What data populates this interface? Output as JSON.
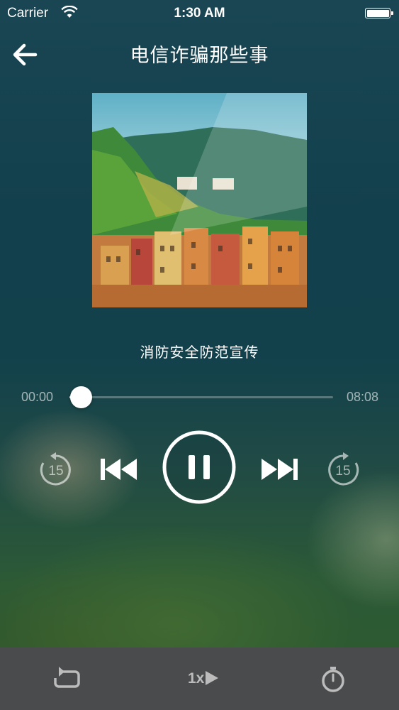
{
  "status_bar": {
    "carrier": "Carrier",
    "time": "1:30 AM"
  },
  "header": {
    "title": "电信诈骗那些事",
    "back_icon": "arrow-left-icon"
  },
  "album": {
    "cover_description_icon": "album-cover-image"
  },
  "track": {
    "title": "消防安全防范宣传"
  },
  "progress": {
    "elapsed": "00:00",
    "total": "08:08",
    "fraction": 0.03
  },
  "controls": {
    "rewind_label": "15",
    "forward_label": "15",
    "state": "playing"
  },
  "bottom_bar": {
    "speed_label": "1x",
    "repeat_icon": "repeat-icon",
    "timer_icon": "timer-icon"
  },
  "colors": {
    "bottom_bar": "#4a4b4d",
    "bottom_icon": "#bcbcbc"
  }
}
